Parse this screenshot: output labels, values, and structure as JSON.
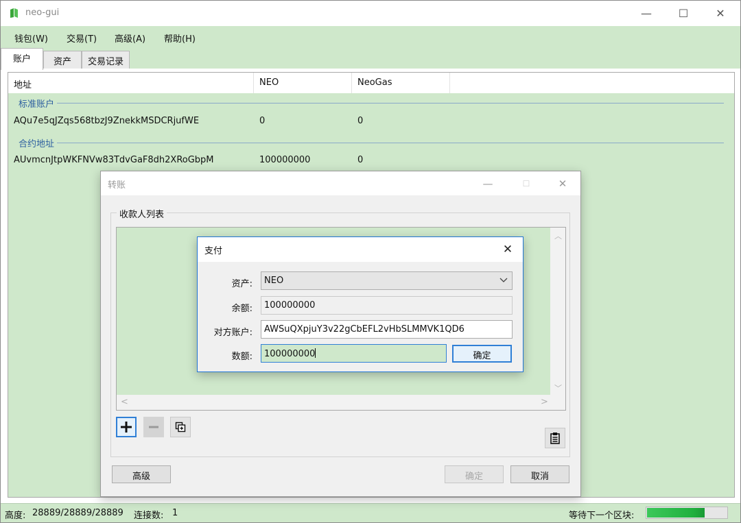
{
  "app": {
    "title": "neo-gui",
    "accent": "#cfe8cb",
    "icon": "neo-logo-icon"
  },
  "window_controls": {
    "minimize": "—",
    "maximize": "☐",
    "close": "✕"
  },
  "menu": [
    {
      "label": "钱包(W)"
    },
    {
      "label": "交易(T)"
    },
    {
      "label": "高级(A)"
    },
    {
      "label": "帮助(H)"
    }
  ],
  "tabs": [
    {
      "label": "账户",
      "active": true
    },
    {
      "label": "资产",
      "active": false
    },
    {
      "label": "交易记录",
      "active": false
    }
  ],
  "accounts": {
    "columns": [
      "地址",
      "NEO",
      "NeoGas"
    ],
    "groups": [
      {
        "label": "标准账户",
        "rows": [
          {
            "address": "AQu7e5qJZqs568tbzJ9ZnekkMSDCRjufWE",
            "neo": "0",
            "gas": "0"
          }
        ]
      },
      {
        "label": "合约地址",
        "rows": [
          {
            "address": "AUvmcnJtpWKFNVw83TdvGaF8dh2XRoGbpM",
            "neo": "100000000",
            "gas": "0"
          }
        ]
      }
    ]
  },
  "status": {
    "height_label": "高度:",
    "height_value": "28889/28889/28889",
    "connections_label": "连接数:",
    "connections_value": "1",
    "waiting_label": "等待下一个区块:",
    "progress": 0.72
  },
  "transfer_dialog": {
    "title": "转账",
    "recipients_label": "收款人列表",
    "add_icon": "plus-icon",
    "remove_icon": "minus-icon",
    "import_icon": "import-icon",
    "paste_icon": "clipboard-icon",
    "advanced_button": "高级",
    "ok_button": "确定",
    "cancel_button": "取消"
  },
  "pay_dialog": {
    "title": "支付",
    "asset_label": "资产:",
    "asset_value": "NEO",
    "balance_label": "余额:",
    "balance_value": "100000000",
    "payee_label": "对方账户:",
    "payee_value": "AWSuQXpjuY3v22gCbEFL2vHbSLMMVK1QD6",
    "amount_label": "数额:",
    "amount_value": "100000000",
    "ok_button": "确定"
  }
}
